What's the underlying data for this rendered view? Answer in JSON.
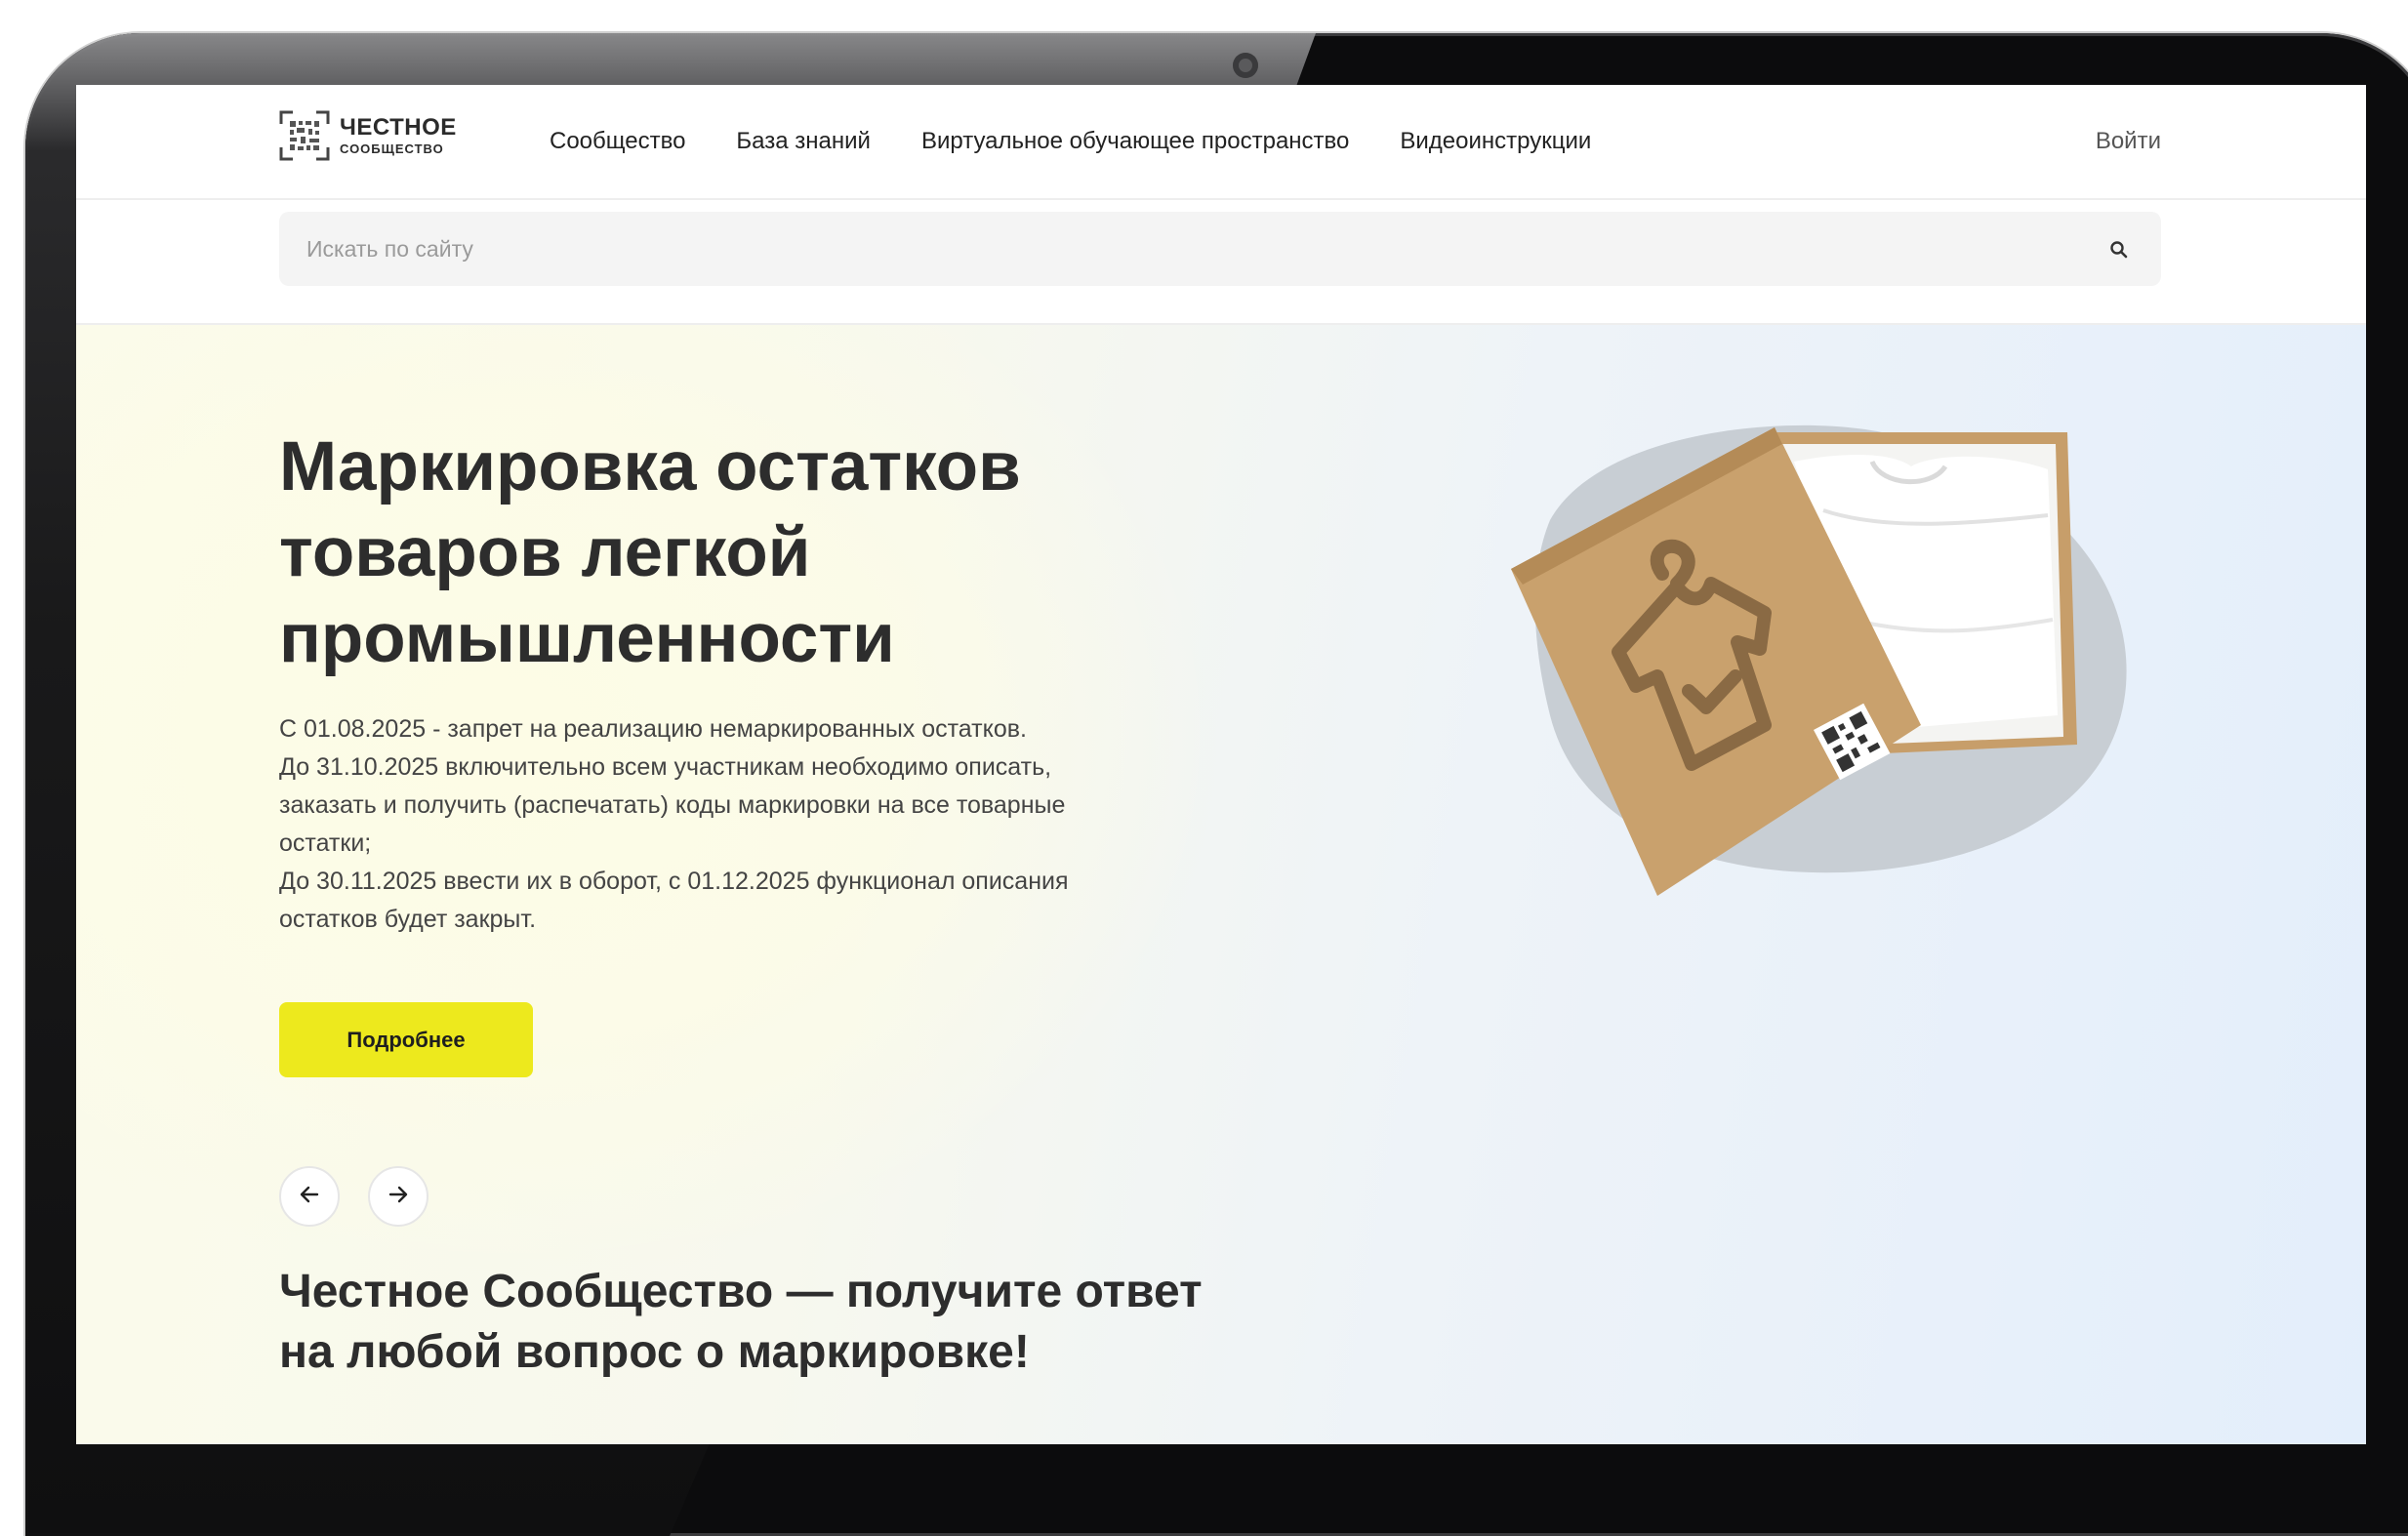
{
  "header": {
    "logo": {
      "title": "ЧЕСТНОЕ",
      "subtitle": "СООБЩЕСТВО"
    },
    "nav": [
      {
        "label": "Сообщество"
      },
      {
        "label": "База знаний"
      },
      {
        "label": "Виртуальное обучающее пространство"
      },
      {
        "label": "Видеоинструкции"
      }
    ],
    "login_label": "Войти"
  },
  "search": {
    "placeholder": "Искать по сайту",
    "value": ""
  },
  "hero": {
    "title": "Маркировка остатков товаров легкой промышленности",
    "paragraphs": [
      "С 01.08.2025 - запрет на реализацию немаркированных остатков.",
      "До 31.10.2025 включительно всем участникам необходимо описать, заказать и получить (распечатать) коды маркировки на все товарные остатки;",
      "До 30.11.2025 ввести их в оборот, с 01.12.2025 функционал описания остатков будет закрыт."
    ],
    "more_button": "Подробнее",
    "image": "box-with-tshirt-illustration"
  },
  "carousel": {
    "prev_icon": "arrow-left-icon",
    "next_icon": "arrow-right-icon"
  },
  "community_title": "Честное Сообщество — получите ответ на любой вопрос о маркировке!",
  "colors": {
    "accent": "#ede91d",
    "text": "#2d2d2d",
    "muted": "#9a9a9a",
    "hero_left": "#fbfbea",
    "hero_right": "#e3eefb"
  }
}
